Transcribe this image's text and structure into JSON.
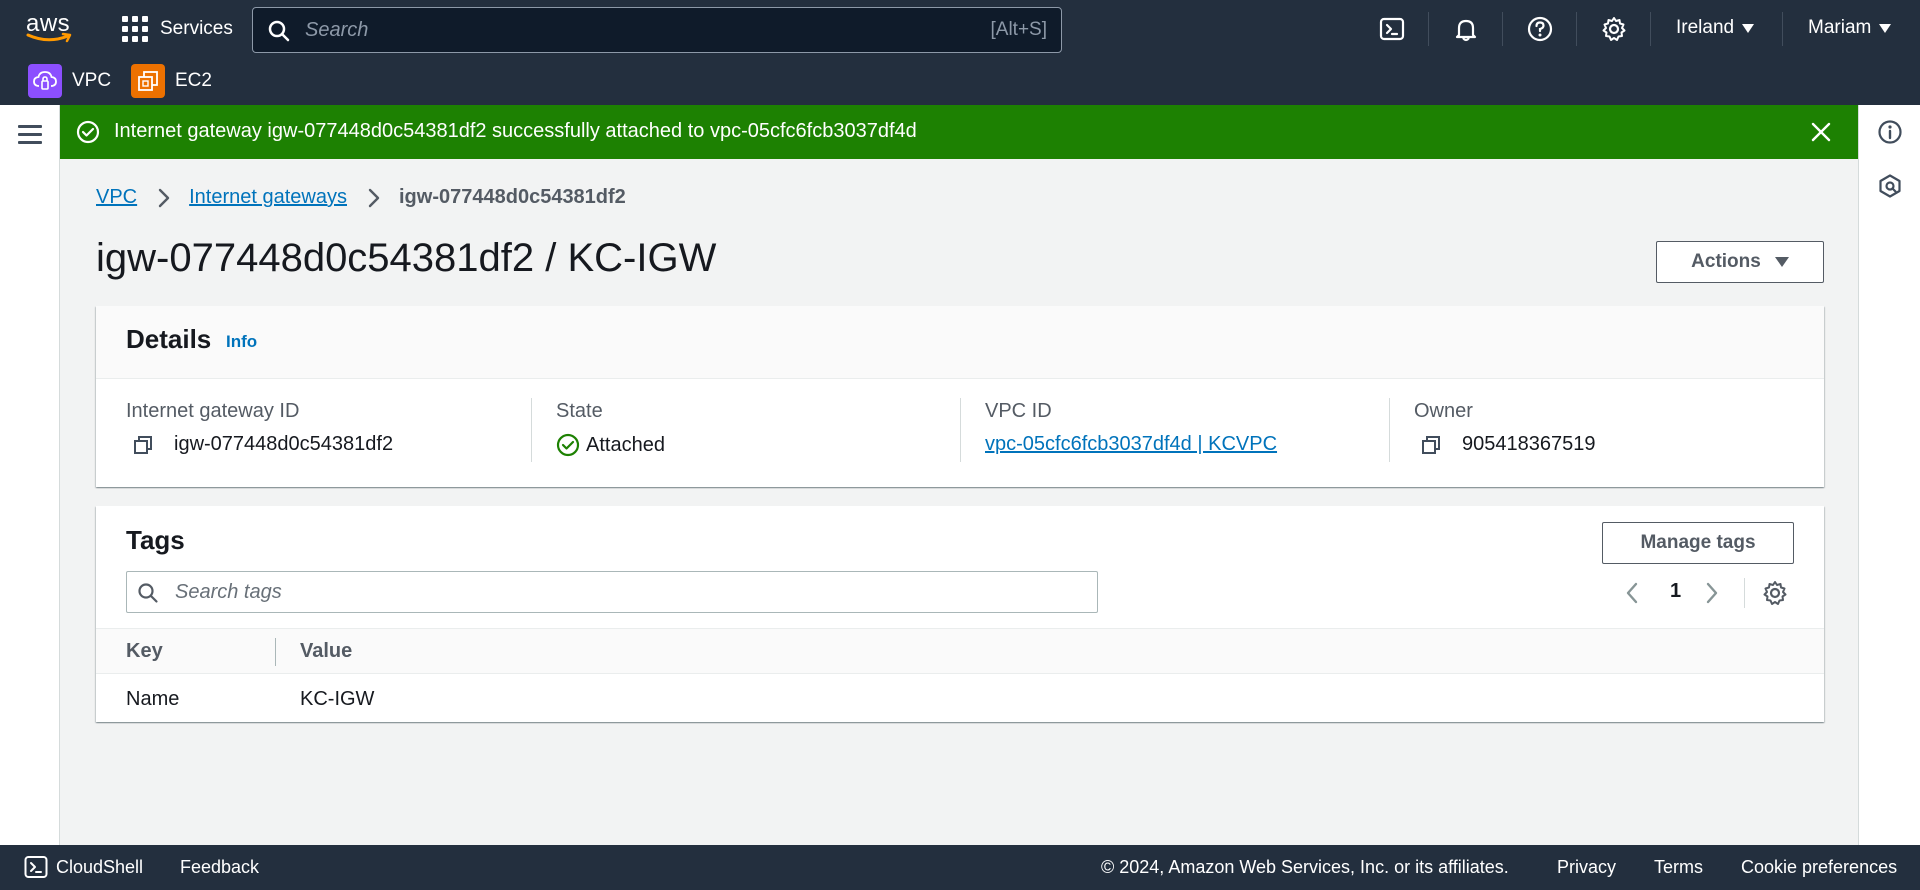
{
  "topnav": {
    "logo_text": "aws",
    "services_label": "Services",
    "search_placeholder": "Search",
    "search_shortcut": "[Alt+S]",
    "region_label": "Ireland",
    "user_label": "Mariam"
  },
  "favorites": [
    {
      "label": "VPC",
      "color": "#8c4fff"
    },
    {
      "label": "EC2",
      "color": "#ed7100"
    }
  ],
  "flash": {
    "message": "Internet gateway igw-077448d0c54381df2 successfully attached to vpc-05cfc6fcb3037df4d",
    "color": "#1d8102"
  },
  "breadcrumb": {
    "items": [
      "VPC",
      "Internet gateways"
    ],
    "current": "igw-077448d0c54381df2"
  },
  "page": {
    "title": "igw-077448d0c54381df2 / KC-IGW",
    "actions_label": "Actions"
  },
  "details": {
    "title": "Details",
    "info_label": "Info",
    "fields": [
      {
        "label": "Internet gateway ID",
        "value": "igw-077448d0c54381df2"
      },
      {
        "label": "State",
        "value": "Attached"
      },
      {
        "label": "VPC ID",
        "value": "vpc-05cfc6fcb3037df4d | KCVPC"
      },
      {
        "label": "Owner",
        "value": "905418367519"
      }
    ]
  },
  "tags": {
    "title": "Tags",
    "manage_label": "Manage tags",
    "search_placeholder": "Search tags",
    "page_number": "1",
    "columns": [
      "Key",
      "Value"
    ],
    "rows": [
      {
        "key": "Name",
        "value": "KC-IGW"
      }
    ]
  },
  "footer": {
    "cloudshell_label": "CloudShell",
    "feedback_label": "Feedback",
    "copyright": "© 2024, Amazon Web Services, Inc. or its affiliates.",
    "privacy_label": "Privacy",
    "terms_label": "Terms",
    "cookie_label": "Cookie preferences"
  }
}
